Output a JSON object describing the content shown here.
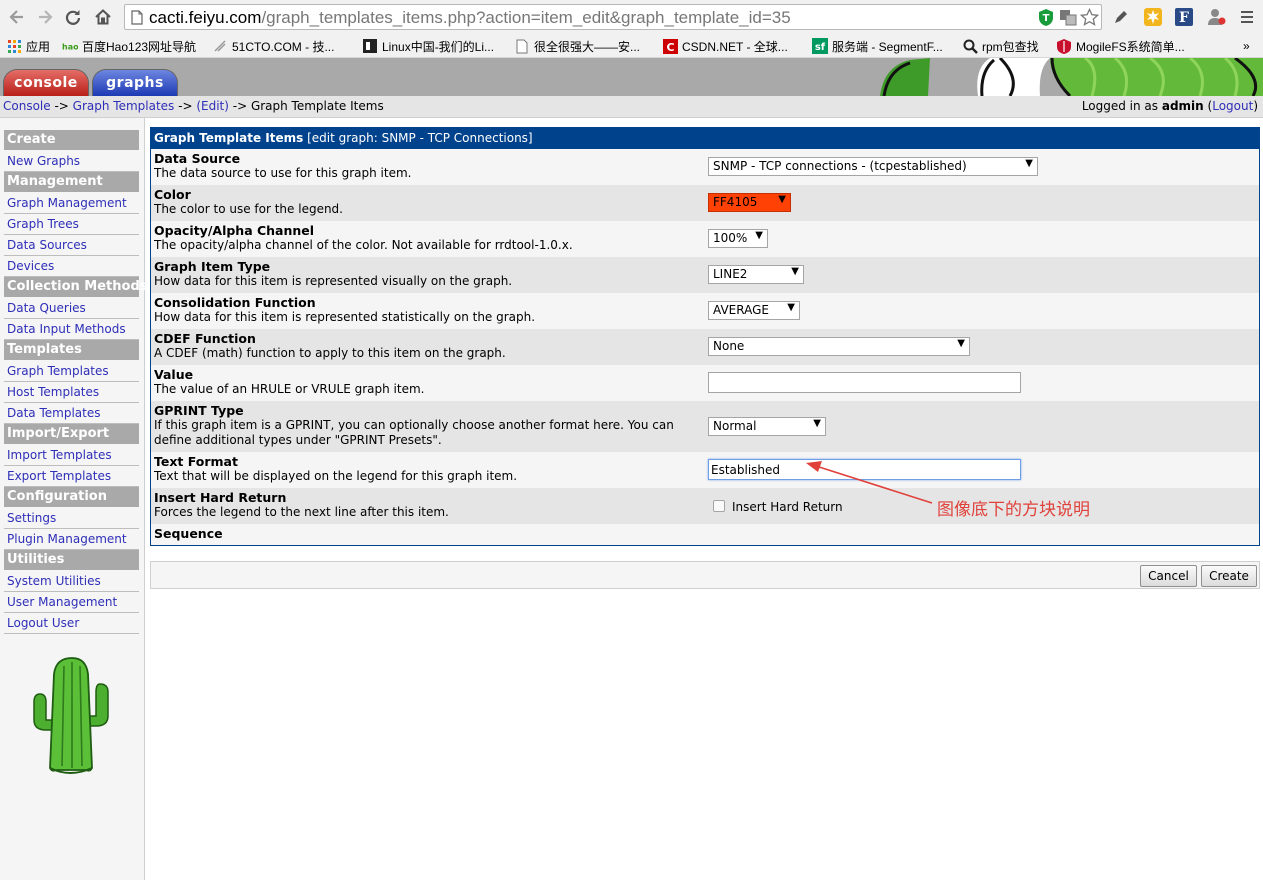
{
  "browser": {
    "url_host": "cacti.feiyu.com",
    "url_rest": "/graph_templates_items.php?action=item_edit&graph_template_id=35",
    "bookmarks": [
      {
        "label": "应用",
        "icon": "apps-grid-icon"
      },
      {
        "label": "百度Hao123网址导航",
        "icon": "hao123-icon"
      },
      {
        "label": "51CTO.COM - 技...",
        "icon": "51cto-icon"
      },
      {
        "label": "Linux中国-我们的Li...",
        "icon": "linux-china-icon"
      },
      {
        "label": "很全很强大——安...",
        "icon": "page-icon"
      },
      {
        "label": "CSDN.NET - 全球...",
        "icon": "csdn-icon"
      },
      {
        "label": "服务端 - SegmentF...",
        "icon": "segmentfault-icon"
      },
      {
        "label": "rpm包查找",
        "icon": "search-icon"
      },
      {
        "label": "MogileFS系统简单...",
        "icon": "shield-icon"
      }
    ],
    "bookmarks_overflow": "»"
  },
  "header": {
    "tab_console": "console",
    "tab_graphs": "graphs"
  },
  "breadcrumb": {
    "console": "Console",
    "sep1": " -> ",
    "graph_templates": "Graph Templates",
    "sep2": " -> ",
    "edit": "(Edit)",
    "sep3": " -> ",
    "current": "Graph Template Items"
  },
  "login": {
    "prefix": "Logged in as ",
    "user": "admin",
    "open": " (",
    "logout": "Logout",
    "close": ")"
  },
  "sidebar": {
    "create": "Create",
    "new_graphs": "New Graphs",
    "management": "Management",
    "graph_management": "Graph Management",
    "graph_trees": "Graph Trees",
    "data_sources": "Data Sources",
    "devices": "Devices",
    "collection_methods": "Collection Methods",
    "data_queries": "Data Queries",
    "data_input_methods": "Data Input Methods",
    "templates": "Templates",
    "graph_templates": "Graph Templates",
    "host_templates": "Host Templates",
    "data_templates": "Data Templates",
    "import_export": "Import/Export",
    "import_templates": "Import Templates",
    "export_templates": "Export Templates",
    "configuration": "Configuration",
    "settings": "Settings",
    "plugin_management": "Plugin Management",
    "utilities": "Utilities",
    "system_utilities": "System Utilities",
    "user_management": "User Management",
    "logout_user": "Logout User"
  },
  "form": {
    "title_bold": "Graph Template Items",
    "title_rest": " [edit graph: SNMP - TCP Connections]",
    "data_source": {
      "title": "Data Source",
      "desc": "The data source to use for this graph item.",
      "value": "SNMP - TCP connections - (tcpestablished)"
    },
    "color": {
      "title": "Color",
      "desc": "The color to use for the legend.",
      "value": "FF4105",
      "swatch": "#ff4105"
    },
    "opacity": {
      "title": "Opacity/Alpha Channel",
      "desc": "The opacity/alpha channel of the color. Not available for rrdtool-1.0.x.",
      "value": "100%"
    },
    "item_type": {
      "title": "Graph Item Type",
      "desc": "How data for this item is represented visually on the graph.",
      "value": "LINE2"
    },
    "consolidation": {
      "title": "Consolidation Function",
      "desc": "How data for this item is represented statistically on the graph.",
      "value": "AVERAGE"
    },
    "cdef": {
      "title": "CDEF Function",
      "desc": "A CDEF (math) function to apply to this item on the graph.",
      "value": "None"
    },
    "value": {
      "title": "Value",
      "desc": "The value of an HRULE or VRULE graph item.",
      "value": ""
    },
    "gprint": {
      "title": "GPRINT Type",
      "desc_line1": "If this graph item is a GPRINT, you can optionally choose another format here. You can",
      "desc_line2": "define additional types under \"GPRINT Presets\".",
      "value": "Normal"
    },
    "text_format": {
      "title": "Text Format",
      "desc": "Text that will be displayed on the legend for this graph item.",
      "value": "Established"
    },
    "hard_return": {
      "title": "Insert Hard Return",
      "desc": "Forces the legend to the next line after this item.",
      "checkbox_label": "Insert Hard Return",
      "checked": false
    },
    "sequence": {
      "title": "Sequence"
    }
  },
  "annotation": {
    "text": "图像底下的方块说明",
    "color": "#e0413b"
  },
  "buttons": {
    "cancel": "Cancel",
    "create": "Create"
  },
  "colors": {
    "form_header": "#00438c",
    "menu_header": "#a9a9a9",
    "link": "#2e2eb8"
  }
}
